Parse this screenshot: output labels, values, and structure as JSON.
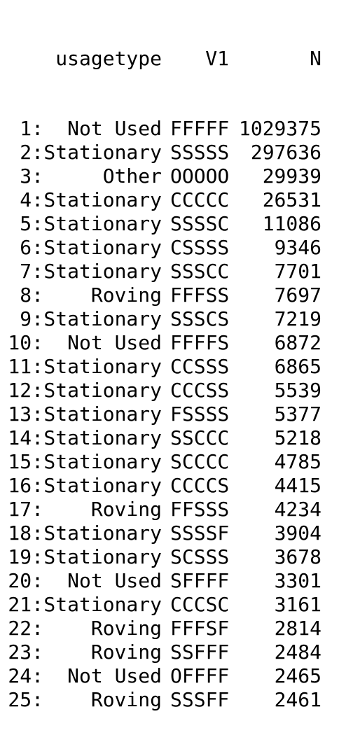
{
  "table": {
    "headers": {
      "usage": "usagetype",
      "v1": "V1",
      "n": "N"
    },
    "rows": [
      {
        "idx": "1:",
        "usage": "Not Used",
        "v1": "FFFFF",
        "n": "1029375"
      },
      {
        "idx": "2:",
        "usage": "Stationary",
        "v1": "SSSSS",
        "n": "297636"
      },
      {
        "idx": "3:",
        "usage": "Other",
        "v1": "OOOOO",
        "n": "29939"
      },
      {
        "idx": "4:",
        "usage": "Stationary",
        "v1": "CCCCC",
        "n": "26531"
      },
      {
        "idx": "5:",
        "usage": "Stationary",
        "v1": "SSSSC",
        "n": "11086"
      },
      {
        "idx": "6:",
        "usage": "Stationary",
        "v1": "CSSSS",
        "n": "9346"
      },
      {
        "idx": "7:",
        "usage": "Stationary",
        "v1": "SSSCC",
        "n": "7701"
      },
      {
        "idx": "8:",
        "usage": "Roving",
        "v1": "FFFSS",
        "n": "7697"
      },
      {
        "idx": "9:",
        "usage": "Stationary",
        "v1": "SSSCS",
        "n": "7219"
      },
      {
        "idx": "10:",
        "usage": "Not Used",
        "v1": "FFFFS",
        "n": "6872"
      },
      {
        "idx": "11:",
        "usage": "Stationary",
        "v1": "CCSSS",
        "n": "6865"
      },
      {
        "idx": "12:",
        "usage": "Stationary",
        "v1": "CCCSS",
        "n": "5539"
      },
      {
        "idx": "13:",
        "usage": "Stationary",
        "v1": "FSSSS",
        "n": "5377"
      },
      {
        "idx": "14:",
        "usage": "Stationary",
        "v1": "SSCCC",
        "n": "5218"
      },
      {
        "idx": "15:",
        "usage": "Stationary",
        "v1": "SCCCC",
        "n": "4785"
      },
      {
        "idx": "16:",
        "usage": "Stationary",
        "v1": "CCCCS",
        "n": "4415"
      },
      {
        "idx": "17:",
        "usage": "Roving",
        "v1": "FFSSS",
        "n": "4234"
      },
      {
        "idx": "18:",
        "usage": "Stationary",
        "v1": "SSSSF",
        "n": "3904"
      },
      {
        "idx": "19:",
        "usage": "Stationary",
        "v1": "SCSSS",
        "n": "3678"
      },
      {
        "idx": "20:",
        "usage": "Not Used",
        "v1": "SFFFF",
        "n": "3301"
      },
      {
        "idx": "21:",
        "usage": "Stationary",
        "v1": "CCCSC",
        "n": "3161"
      },
      {
        "idx": "22:",
        "usage": "Roving",
        "v1": "FFFSF",
        "n": "2814"
      },
      {
        "idx": "23:",
        "usage": "Roving",
        "v1": "SSFFF",
        "n": "2484"
      },
      {
        "idx": "24:",
        "usage": "Not Used",
        "v1": "OFFFF",
        "n": "2465"
      },
      {
        "idx": "25:",
        "usage": "Roving",
        "v1": "SSSFF",
        "n": "2461"
      }
    ]
  }
}
